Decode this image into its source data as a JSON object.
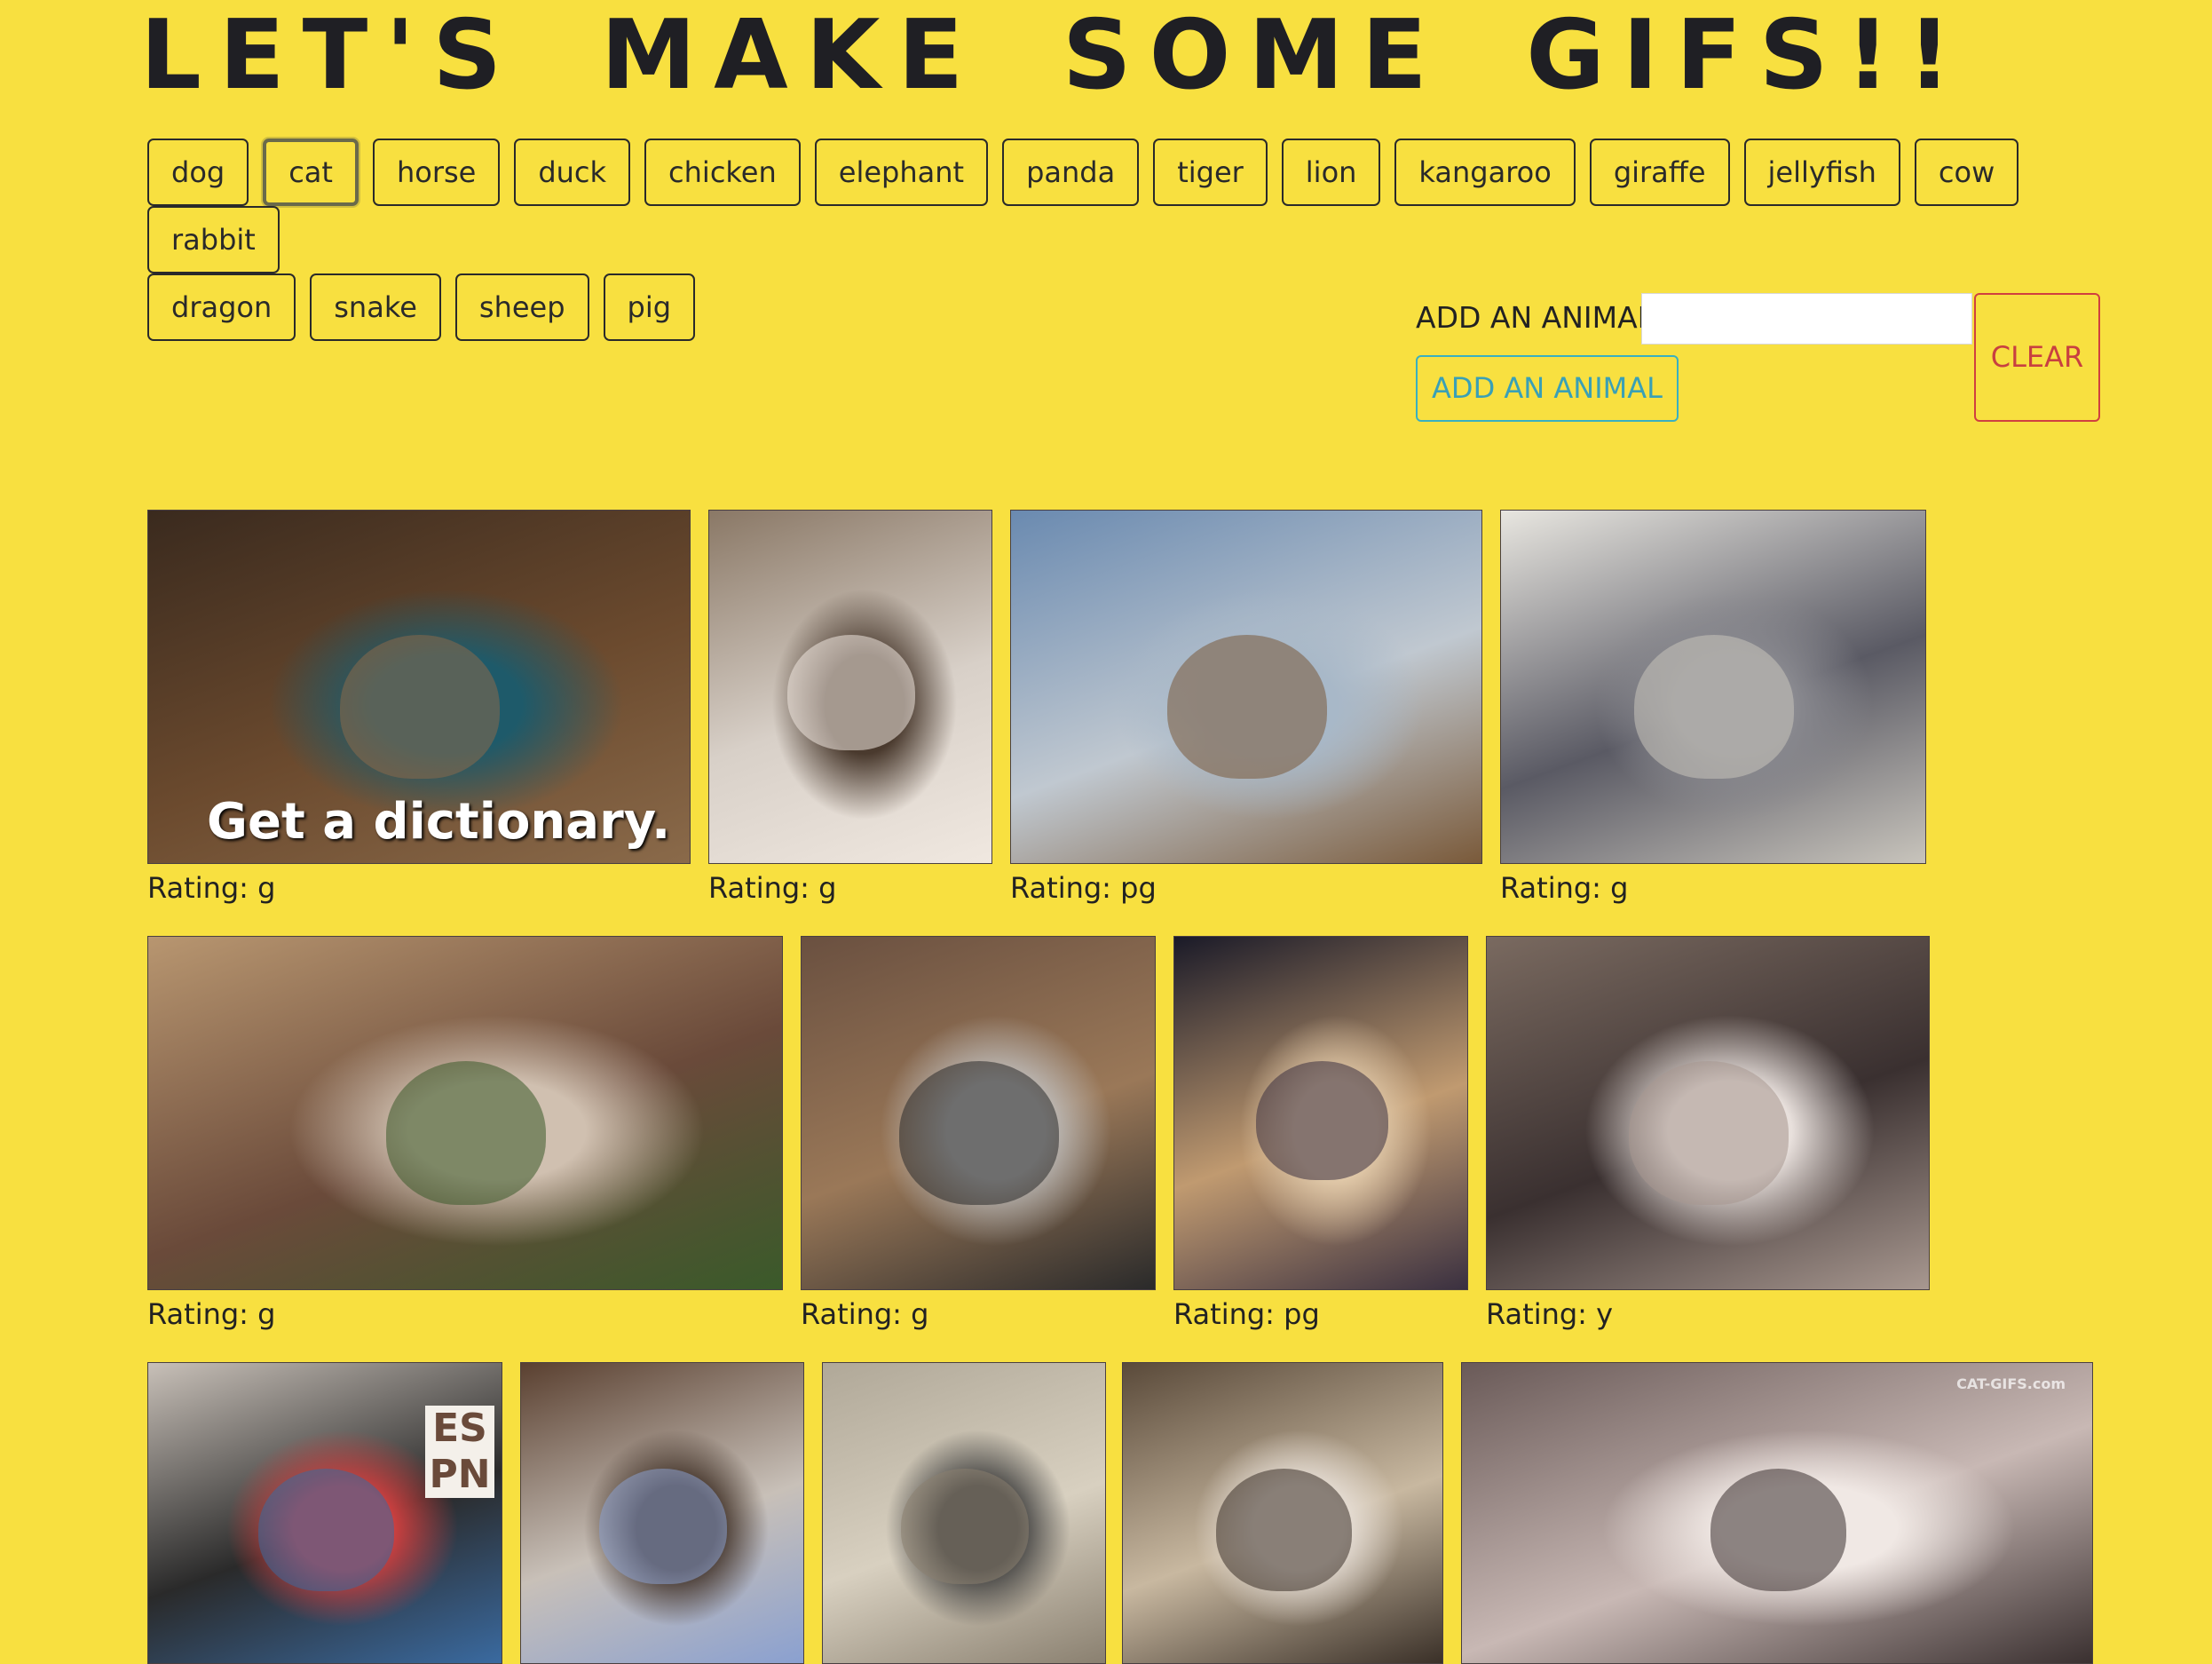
{
  "page": {
    "title": "LET'S MAKE SOME GIFS!!",
    "background_color": "#f8e040"
  },
  "animal_buttons": [
    "dog",
    "cat",
    "horse",
    "duck",
    "chicken",
    "elephant",
    "panda",
    "tiger",
    "lion",
    "kangaroo",
    "giraffe",
    "jellyfish",
    "cow",
    "rabbit",
    "dragon",
    "snake",
    "sheep",
    "pig"
  ],
  "selected_animal": "cat",
  "add_form": {
    "label": "ADD AN ANIMAL",
    "input_value": "",
    "button_label": "ADD AN ANIMAL",
    "clear_label": "CLEAR",
    "add_color": "#3aa0b6",
    "clear_color": "#c84040"
  },
  "gifs": [
    {
      "subject": "persian cat on bookshelf",
      "rating": "Rating: g",
      "overlay": "Get a dictionary."
    },
    {
      "subject": "toddler and cat in kitchen",
      "rating": "Rating: g",
      "overlay": ""
    },
    {
      "subject": "cat with toy dog and lightsaber",
      "rating": "Rating: pg",
      "overlay": ""
    },
    {
      "subject": "grey tabby cat crouching",
      "rating": "Rating: g",
      "overlay": ""
    },
    {
      "subject": "cat with filter face",
      "rating": "Rating: g",
      "overlay": ""
    },
    {
      "subject": "cat typing on laptop",
      "rating": "Rating: g",
      "overlay": ""
    },
    {
      "subject": "kitten sleeping upright",
      "rating": "Rating: pg",
      "overlay": ""
    },
    {
      "subject": "kitten playing on back",
      "rating": "Rating: y",
      "overlay": ""
    },
    {
      "subject": "cat on carpet near painting",
      "rating": "",
      "overlay": "",
      "sign": "ES PN"
    },
    {
      "subject": "cat in kitchen on floor",
      "rating": "",
      "overlay": ""
    },
    {
      "subject": "cat standing on beach",
      "rating": "",
      "overlay": ""
    },
    {
      "subject": "white cat dancing on rug",
      "rating": "",
      "overlay": ""
    },
    {
      "subject": "grey and white cat close-up",
      "rating": "",
      "overlay": "",
      "watermark": "CAT-GIFS.com"
    }
  ]
}
